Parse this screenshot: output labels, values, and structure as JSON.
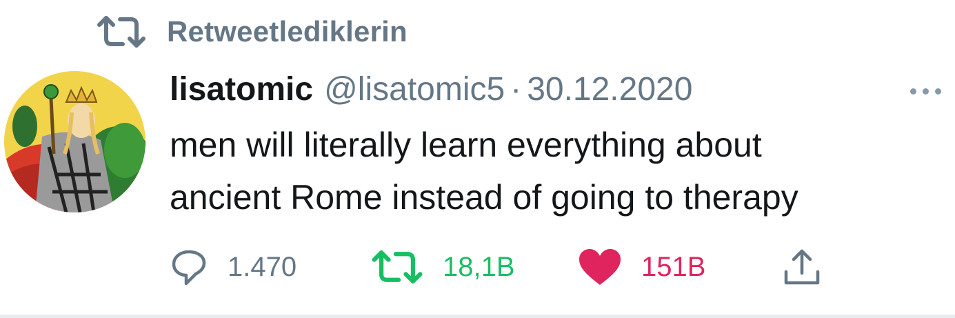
{
  "retweet_context": {
    "label": "Retweetlediklerin",
    "icon": "retweet-icon"
  },
  "tweet": {
    "avatar_icon": "avatar-tarot-queen",
    "display_name": "lisatomic",
    "handle": "@lisatomic5",
    "separator": "·",
    "date": "30.12.2020",
    "more_icon": "more-icon",
    "text_lines": [
      "men will literally learn everything about",
      "ancient Rome instead of going to therapy"
    ],
    "actions": {
      "reply": {
        "icon": "reply-icon",
        "count": "1.470"
      },
      "retweet": {
        "icon": "retweet-icon",
        "count": "18,1B"
      },
      "like": {
        "icon": "heart-icon",
        "count": "151B"
      },
      "share": {
        "icon": "share-icon"
      }
    }
  },
  "colors": {
    "secondary_text": "#657786",
    "retweet_green": "#17bf63",
    "like_red": "#e0245e",
    "primary_text": "#14171a"
  }
}
